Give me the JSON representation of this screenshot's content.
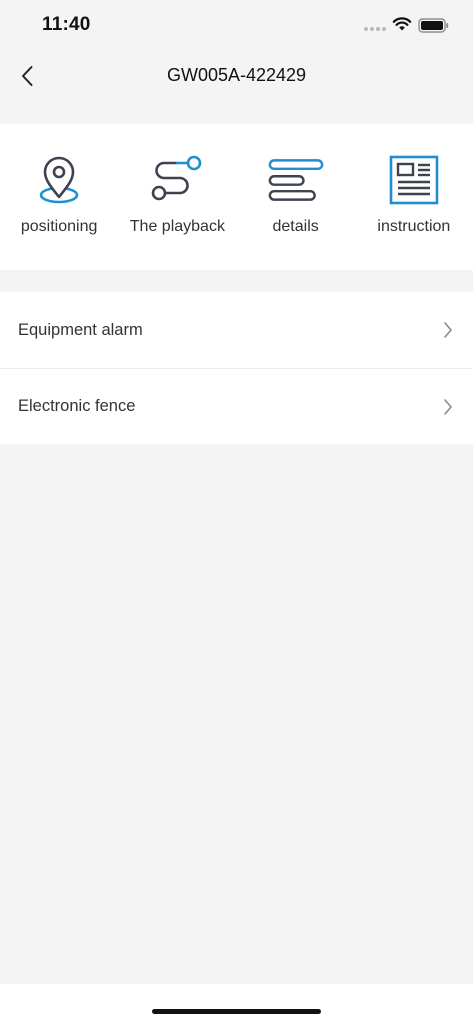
{
  "status_bar": {
    "time": "11:40",
    "icons": [
      "signal-dots-icon",
      "wifi-icon",
      "battery-icon"
    ]
  },
  "nav": {
    "title": "GW005A-422429",
    "back_icon": "chevron-left-icon"
  },
  "colors": {
    "accent": "#1f8fcf",
    "icon_dark": "#3f4250",
    "background": "#f4f4f4"
  },
  "quick_actions": [
    {
      "label": "positioning",
      "icon": "location-pin-icon"
    },
    {
      "label": "The playback",
      "icon": "route-playback-icon"
    },
    {
      "label": "details",
      "icon": "details-list-icon"
    },
    {
      "label": "instruction",
      "icon": "instruction-document-icon"
    }
  ],
  "menu": [
    {
      "label": "Equipment alarm",
      "icon": "chevron-right-icon"
    },
    {
      "label": "Electronic fence",
      "icon": "chevron-right-icon"
    }
  ]
}
